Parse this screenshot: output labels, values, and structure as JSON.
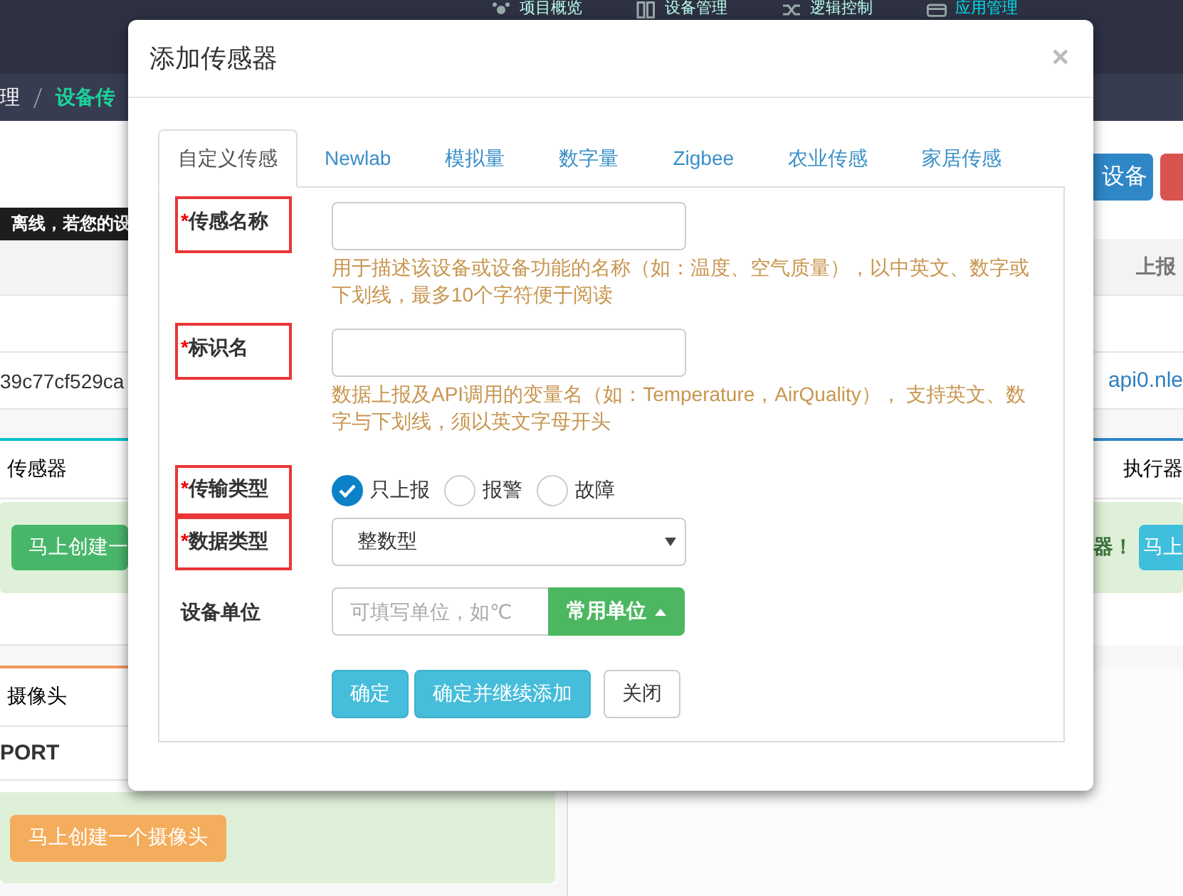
{
  "nav": [
    {
      "label": "项目概览",
      "selected": false
    },
    {
      "label": "设备管理",
      "selected": false
    },
    {
      "label": "逻辑控制",
      "selected": false
    },
    {
      "label": "应用管理",
      "selected": true
    }
  ],
  "breadcrumb": [
    {
      "label": "理",
      "selected": false
    },
    {
      "label": "设备传",
      "selected": true
    }
  ],
  "device_buttons": [
    {
      "label": "设备",
      "kind": "primary"
    },
    {
      "kind": "danger"
    }
  ],
  "tooltip": "离线，若您的设",
  "device_table": {
    "columns": [
      null,
      {
        "label": "上报"
      }
    ],
    "rows": [
      [
        "39c77cf529ca",
        "api0.nle"
      ]
    ]
  },
  "sensor_panel": {
    "tab": "传感器",
    "button": "马上创建一"
  },
  "actuator_panel": {
    "tab": "执行器",
    "message": "器！",
    "button": "马上"
  },
  "camera_panel": {
    "tab": "摄像头",
    "column": "PORT",
    "button": "马上创建一个摄像头"
  },
  "dialog": {
    "title": "添加传感器",
    "close": "×",
    "tabs": [
      {
        "label": "自定义传感",
        "selected": true
      },
      {
        "label": "Newlab",
        "selected": false
      },
      {
        "label": "模拟量",
        "selected": false
      },
      {
        "label": "数字量",
        "selected": false
      },
      {
        "label": "Zigbee",
        "selected": false
      },
      {
        "label": "农业传感",
        "selected": false
      },
      {
        "label": "家居传感",
        "selected": false
      }
    ],
    "fields": [
      {
        "kind": "text",
        "mark": "*",
        "label": "传感名称",
        "highlighted": true,
        "help": "用于描述该设备或设备功能的名称（如：温度、空气质量），以中英文、数字或下划线，最多10个字符便于阅读"
      },
      {
        "kind": "text",
        "mark": "*",
        "label": "标识名",
        "highlighted": true,
        "help": "数据上报及API调用的变量名（如：Temperature，AirQuality）， 支持英文、数字与下划线，须以英文字母开头"
      },
      {
        "kind": "radio",
        "mark": "*",
        "label": "传输类型",
        "highlighted": true,
        "options": [
          {
            "label": "只上报",
            "selected": true
          },
          {
            "label": "报警",
            "selected": false
          },
          {
            "label": "故障",
            "selected": false
          }
        ]
      },
      {
        "kind": "select",
        "mark": "*",
        "label": "数据类型",
        "highlighted": true,
        "value": "整数型"
      },
      {
        "kind": "unit",
        "label": "设备单位",
        "highlighted": false,
        "placeholder": "可填写单位，如℃",
        "button": "常用单位"
      }
    ],
    "buttons": [
      {
        "label": "确定",
        "kind": "primary"
      },
      {
        "label": "确定并继续添加",
        "kind": "primary"
      },
      {
        "label": "关闭",
        "kind": "default"
      }
    ]
  }
}
